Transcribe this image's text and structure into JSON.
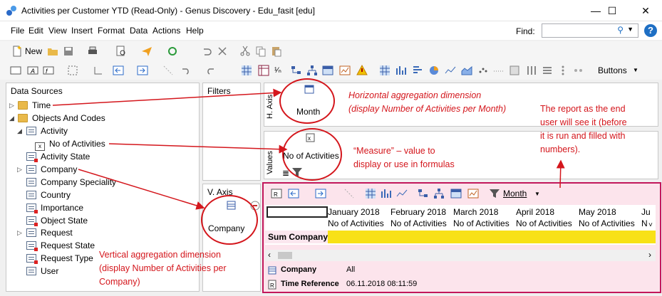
{
  "window": {
    "title": "Activities per Customer YTD (Read-Only) - Genus Discovery - Edu_fasit [edu]",
    "minimize": "—",
    "maximize": "☐",
    "close": "✕"
  },
  "menu": {
    "items": [
      "File",
      "Edit",
      "View",
      "Insert",
      "Format",
      "Data",
      "Actions",
      "Help"
    ],
    "find_label": "Find:"
  },
  "toolbar1": {
    "new_label": "New"
  },
  "toolbar2": {
    "buttons_label": "Buttons"
  },
  "data_sources": {
    "header": "Data Sources",
    "items": [
      {
        "label": "Time",
        "kind": "folder"
      },
      {
        "label": "Objects And Codes",
        "kind": "folder"
      },
      {
        "label": "Activity",
        "kind": "table"
      },
      {
        "label": "No of Activities",
        "kind": "measure"
      },
      {
        "label": "Activity State",
        "kind": "table-red"
      },
      {
        "label": "Company",
        "kind": "table"
      },
      {
        "label": "Company Speciality",
        "kind": "table"
      },
      {
        "label": "Country",
        "kind": "table"
      },
      {
        "label": "Importance",
        "kind": "table-red"
      },
      {
        "label": "Object State",
        "kind": "table-red"
      },
      {
        "label": "Request",
        "kind": "table"
      },
      {
        "label": "Request State",
        "kind": "table-red"
      },
      {
        "label": "Request Type",
        "kind": "table-red"
      },
      {
        "label": "User",
        "kind": "table"
      }
    ]
  },
  "filters": {
    "header": "Filters"
  },
  "h_axis": {
    "side_label": "H. Axis",
    "item": "Month"
  },
  "values": {
    "side_label": "Values",
    "item": "No of Activities"
  },
  "v_axis": {
    "header": "V. Axis",
    "item": "Company"
  },
  "annotations": {
    "horizontal": [
      "Horizontal aggregation dimension",
      "(display Number of Activities per Month)"
    ],
    "measure": [
      "“Measure” – value to",
      "display or use in formulas"
    ],
    "report": [
      "The report as the end",
      "user will see it (before",
      "it is run and filled with",
      "numbers)."
    ],
    "vertical": [
      "Vertical aggregation dimension",
      "(display Number of Activities per",
      "Company)"
    ]
  },
  "report": {
    "toolbar_month": "Month",
    "months": [
      "January 2018",
      "February 2018",
      "March 2018",
      "April 2018",
      "May 2018",
      "Ju"
    ],
    "measure_header": "No of Activities",
    "row_label": "Sum Company",
    "filters": [
      {
        "label": "Company",
        "value": "All"
      },
      {
        "label": "Time Reference",
        "value": "06.11.2018 08:11:59"
      }
    ]
  }
}
